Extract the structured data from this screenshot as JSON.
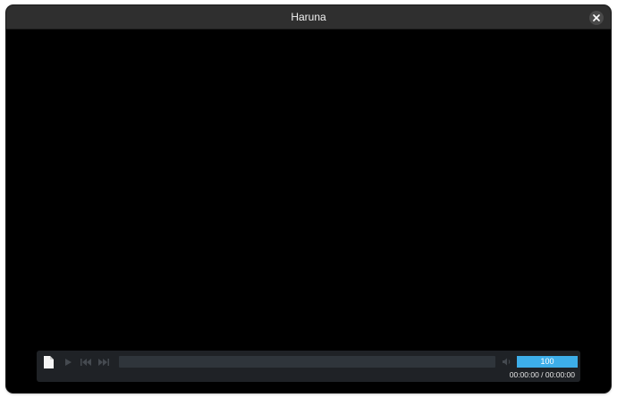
{
  "window": {
    "title": "Haruna"
  },
  "icons": {
    "close": "close-icon",
    "file": "file-icon",
    "play": "play-icon",
    "previous": "skip-previous-icon",
    "next": "skip-next-icon",
    "volume": "volume-icon"
  },
  "player": {
    "progress_fraction": 0,
    "volume": "100",
    "volume_fraction": 1,
    "time_display": "00:00:00 / 00:00:00"
  },
  "colors": {
    "accent": "#3daee9",
    "titlebar": "#2f2f2f",
    "video_background": "#000000",
    "controls_background": "#1f2226"
  }
}
